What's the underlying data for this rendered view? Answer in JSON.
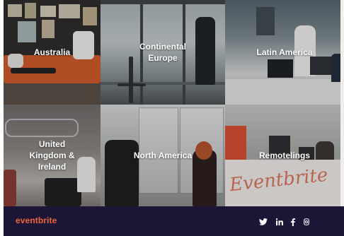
{
  "regions": [
    {
      "id": "t1",
      "label": "Australia"
    },
    {
      "id": "t2",
      "label": "Continental\nEurope"
    },
    {
      "id": "t3",
      "label": "Latin America"
    },
    {
      "id": "t4",
      "label": "United\nKingdom &\nIreland"
    },
    {
      "id": "t5",
      "label": "North America"
    },
    {
      "id": "t6",
      "label": "Remotelings"
    }
  ],
  "footer": {
    "brand": "eventbrite",
    "brand_color": "#f0653a",
    "background_color": "#1c1536",
    "social_icons": [
      "twitter-icon",
      "linkedin-icon",
      "facebook-icon",
      "instagram-icon"
    ]
  },
  "decor": {
    "sign_text": "Eventbrite"
  }
}
